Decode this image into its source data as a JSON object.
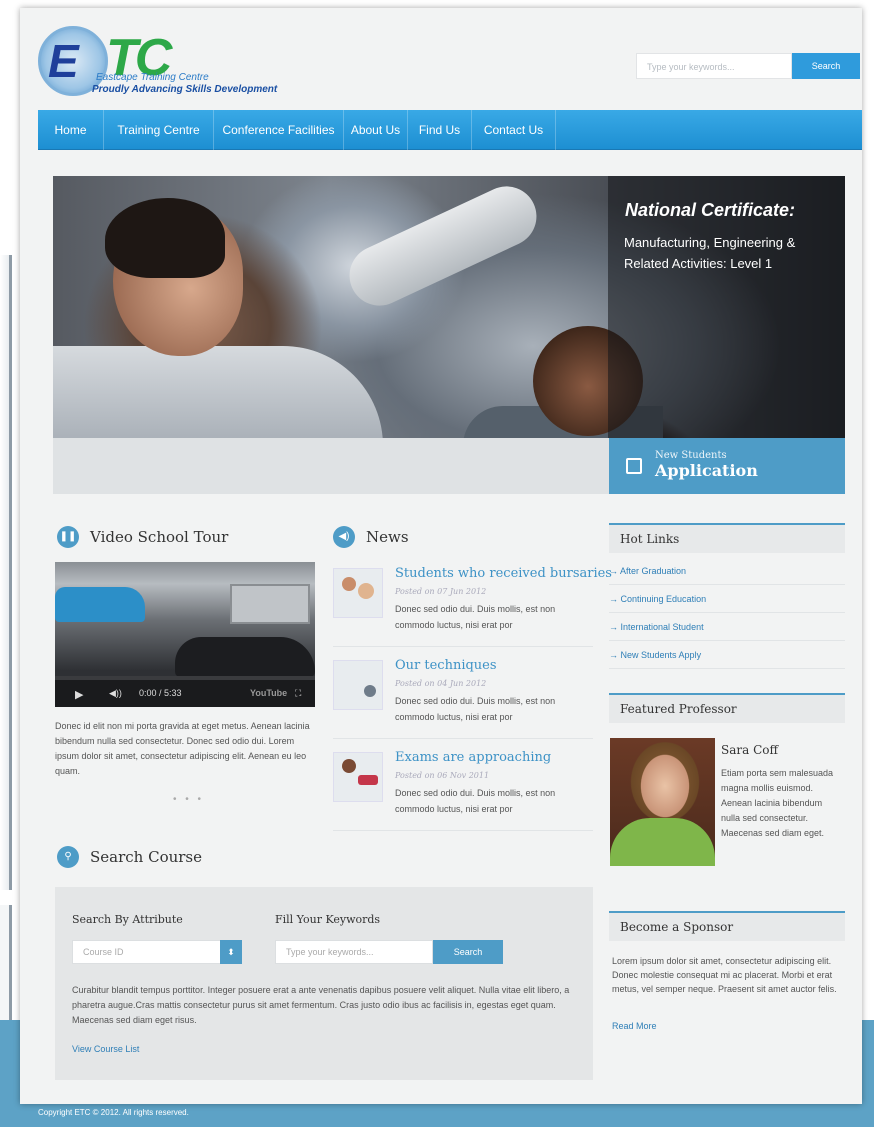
{
  "logo": {
    "text_e": "E",
    "text_tc": "TC",
    "subtitle": "Eastcape Training Centre",
    "tagline": "Proudly Advancing Skills Development"
  },
  "header_search": {
    "placeholder": "Type your keywords...",
    "button": "Search"
  },
  "nav": {
    "items": [
      "Home",
      "Training Centre",
      "Conference Facilities",
      "About Us",
      "Find Us",
      "Contact Us"
    ]
  },
  "hero": {
    "title": "National Certificate:",
    "subtitle": "Manufacturing, Engineering & Related Activities: Level 1"
  },
  "application": {
    "small": "New Students",
    "big": "Application"
  },
  "video_tour": {
    "title": "Video School Tour",
    "time": "0:00 / 5:33",
    "youtube": "YouTube",
    "description": "Donec id elit non mi porta gravida at eget metus. Aenean lacinia bibendum nulla sed consectetur. Donec sed odio dui. Lorem ipsum dolor sit amet, consectetur adipiscing elit. Aenean eu leo quam.",
    "dots": "• • •"
  },
  "news": {
    "title": "News",
    "items": [
      {
        "title": "Students who received bursaries",
        "date": "Posted on 07 Jun 2012",
        "text": "Donec sed odio dui. Duis mollis, est non commodo luctus, nisi erat por"
      },
      {
        "title": "Our techniques",
        "date": "Posted on 04 Jun 2012",
        "text": "Donec sed odio dui. Duis mollis, est non commodo luctus, nisi erat por"
      },
      {
        "title": "Exams are approaching",
        "date": "Posted on 06 Nov 2011",
        "text": "Donec sed odio dui. Duis mollis, est non commodo luctus, nisi erat por"
      }
    ]
  },
  "hot_links": {
    "title": "Hot Links",
    "items": [
      "After Graduation",
      "Continuing Education",
      "International Student",
      "New Students Apply"
    ]
  },
  "featured_professor": {
    "title": "Featured Professor",
    "name": "Sara Coff",
    "bio": "Etiam porta sem malesuada magna mollis euismod. Aenean lacinia bibendum nulla sed consectetur. Maecenas sed diam eget."
  },
  "sponsor": {
    "title": "Become a Sponsor",
    "text": "Lorem ipsum dolor sit amet, consectetur adipiscing elit. Donec molestie consequat mi ac placerat. Morbi et erat metus, vel semper neque. Praesent sit amet auctor felis.",
    "read_more": "Read More"
  },
  "search_course": {
    "title": "Search Course",
    "attr_title": "Search By Attribute",
    "course_placeholder": "Course ID",
    "kw_title": "Fill Your Keywords",
    "kw_placeholder": "Type your keywords...",
    "button": "Search",
    "text": "Curabitur blandit tempus porttitor. Integer posuere erat a ante venenatis dapibus posuere velit aliquet. Nulla vitae elit libero, a pharetra augue.Cras mattis consectetur purus sit amet fermentum. Cras justo odio ibus ac facilisis in, egestas eget quam. Maecenas sed diam eget risus.",
    "view_list": "View Course List"
  },
  "footer": {
    "copyright": "Copyright ETC © 2012. All rights reserved."
  },
  "colors": {
    "accent": "#4e9cc7",
    "nav": "#2f9bdc",
    "footer": "#5da2c6"
  }
}
